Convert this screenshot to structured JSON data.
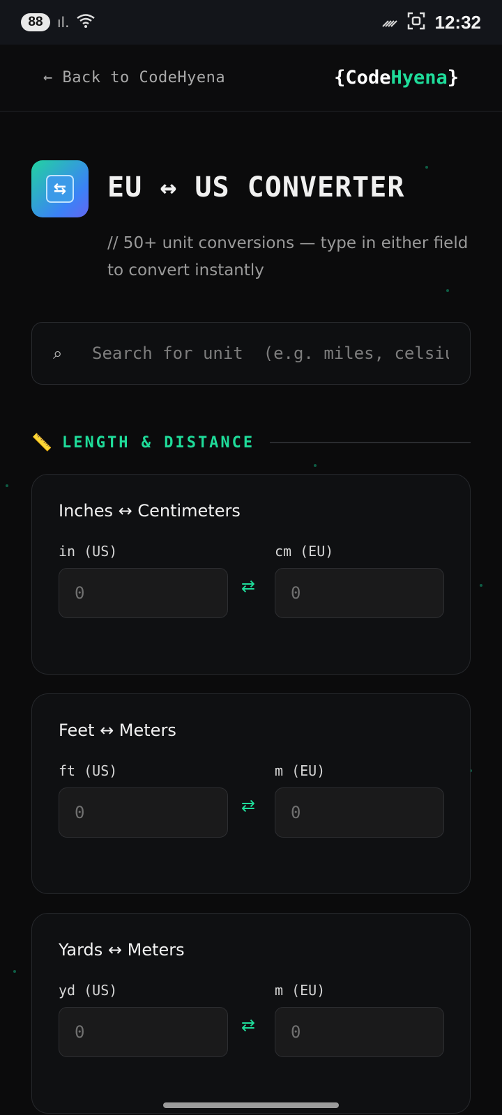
{
  "status_bar": {
    "battery": "88",
    "time": "12:32",
    "icons": [
      "signal-icon",
      "wifi-icon",
      "vibrate-icon",
      "screenshot-icon"
    ]
  },
  "header": {
    "back_label": "← Back to CodeHyena",
    "logo_prefix": "{Code",
    "logo_accent": "Hyena",
    "logo_suffix": "}"
  },
  "hero": {
    "app_icon": "arrows-cycle-icon",
    "app_icon_glyph": "⇆",
    "title": "EU ↔ US CONVERTER",
    "subtitle": "// 50+ unit conversions — type in either field to convert instantly"
  },
  "search": {
    "icon": "search-icon",
    "placeholder": "Search for unit  (e.g. miles, celsius...)",
    "value": ""
  },
  "section": {
    "icon": "ruler-icon",
    "icon_glyph": "📏",
    "title": "LENGTH & DISTANCE"
  },
  "converters": [
    {
      "title": "Inches ↔ Centimeters",
      "left_label": "in (US)",
      "right_label": "cm (EU)",
      "left_placeholder": "0",
      "right_placeholder": "0"
    },
    {
      "title": "Feet ↔ Meters",
      "left_label": "ft (US)",
      "right_label": "m (EU)",
      "left_placeholder": "0",
      "right_placeholder": "0"
    },
    {
      "title": "Yards ↔ Meters",
      "left_label": "yd (US)",
      "right_label": "m (EU)",
      "left_placeholder": "0",
      "right_placeholder": "0"
    }
  ],
  "swap_glyph": "⇄",
  "colors": {
    "background": "#0b0b0c",
    "accent": "#1fdc9a",
    "card_border": "#26282c",
    "field_bg": "#1a1a1b"
  }
}
